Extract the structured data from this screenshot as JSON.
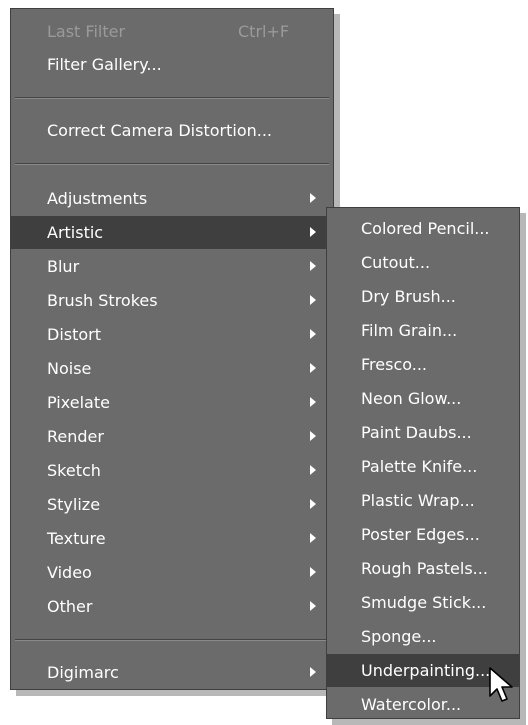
{
  "menu": {
    "last_filter": {
      "label": "Last Filter",
      "shortcut": "Ctrl+F"
    },
    "filter_gallery": "Filter Gallery...",
    "correct_camera_distortion": "Correct Camera Distortion...",
    "submenus": [
      "Adjustments",
      "Artistic",
      "Blur",
      "Brush Strokes",
      "Distort",
      "Noise",
      "Pixelate",
      "Render",
      "Sketch",
      "Stylize",
      "Texture",
      "Video",
      "Other"
    ],
    "digimarc": "Digimarc"
  },
  "artistic_submenu": {
    "items": [
      "Colored Pencil...",
      "Cutout...",
      "Dry Brush...",
      "Film Grain...",
      "Fresco...",
      "Neon Glow...",
      "Paint Daubs...",
      "Palette Knife...",
      "Plastic Wrap...",
      "Poster Edges...",
      "Rough Pastels...",
      "Smudge Stick...",
      "Sponge...",
      "Underpainting...",
      "Watercolor..."
    ],
    "highlighted": "Underpainting..."
  },
  "colors": {
    "menu_background": "#6b6b6b",
    "highlight": "#3f3f3f",
    "text": "#ffffff",
    "disabled_text": "#9a9a9a"
  },
  "cursor_icon": "arrow-pointer-icon"
}
